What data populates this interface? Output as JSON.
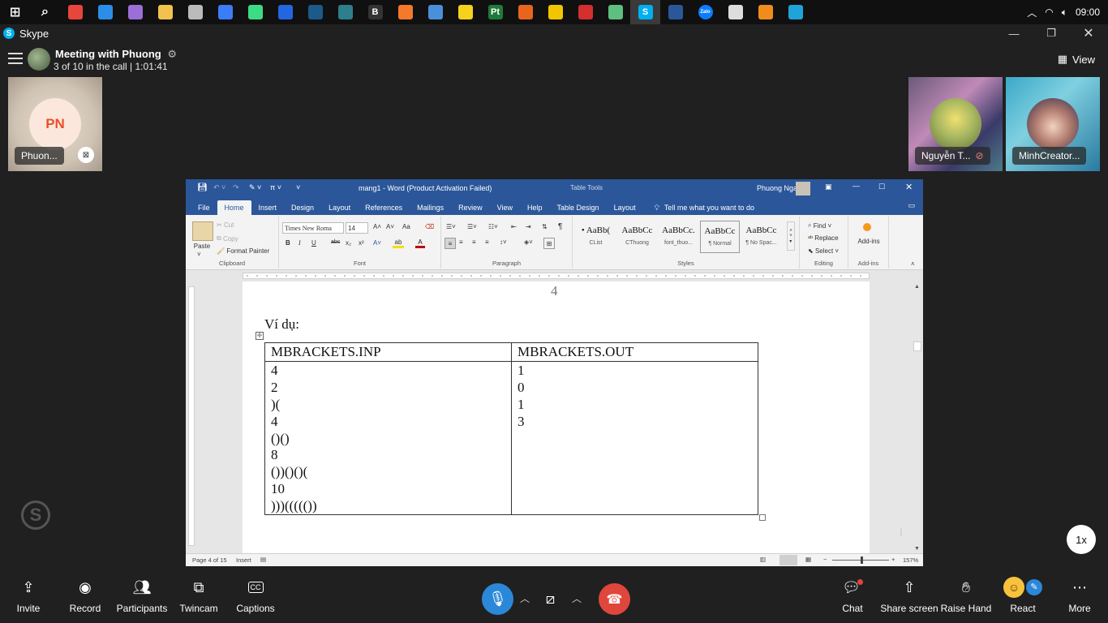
{
  "taskbar": {
    "time": "09:00",
    "apps": [
      {
        "icon": "start-icon",
        "glyph": "",
        "color": "#ffffff"
      },
      {
        "icon": "search-icon",
        "glyph": "",
        "color": "#ffffff"
      },
      {
        "icon": "chrome-icon",
        "glyph": "",
        "color": "#e8453c"
      },
      {
        "icon": "vscode-icon",
        "glyph": "",
        "color": "#2b8ee6"
      },
      {
        "icon": "store-icon",
        "glyph": "",
        "color": "#9b6ed8"
      },
      {
        "icon": "folder-icon",
        "glyph": "",
        "color": "#f2c14e"
      },
      {
        "icon": "check-app-icon",
        "glyph": "",
        "color": "#bbbbbb"
      },
      {
        "icon": "app-blue-icon",
        "glyph": "",
        "color": "#3c7cf6"
      },
      {
        "icon": "android-icon",
        "glyph": "",
        "color": "#3ddc84"
      },
      {
        "icon": "app-square-icon",
        "glyph": "",
        "color": "#2466e0"
      },
      {
        "icon": "steam-icon",
        "glyph": "",
        "color": "#1b5a8a"
      },
      {
        "icon": "app-dark-icon",
        "glyph": "",
        "color": "#2d7f8c"
      },
      {
        "icon": "b-app-icon",
        "glyph": "B",
        "color": "#333333"
      },
      {
        "icon": "blender-icon",
        "glyph": "",
        "color": "#f5792a"
      },
      {
        "icon": "gear-app-icon",
        "glyph": "",
        "color": "#4a90d9"
      },
      {
        "icon": "yellow-app-icon",
        "glyph": "",
        "color": "#f5d21b"
      },
      {
        "icon": "packet-tracer-icon",
        "glyph": "Pt",
        "color": "#1e7a3b"
      },
      {
        "icon": "search-app-icon",
        "glyph": "",
        "color": "#e8661c"
      },
      {
        "icon": "duck-icon",
        "glyph": "",
        "color": "#f2c500"
      },
      {
        "icon": "record-app-icon",
        "glyph": "",
        "color": "#d32f2f"
      },
      {
        "icon": "diamond-app-icon",
        "glyph": "",
        "color": "#5fbf7f"
      },
      {
        "icon": "skype-taskbar-icon",
        "glyph": "S",
        "color": "#00aff0"
      },
      {
        "icon": "word-taskbar-icon",
        "glyph": "",
        "color": "#2b579a"
      },
      {
        "icon": "zalo-icon",
        "glyph": "Zalo",
        "color": "#0a7cff"
      },
      {
        "icon": "file-app-icon",
        "glyph": "",
        "color": "#dddddd"
      },
      {
        "icon": "sublime-icon",
        "glyph": "",
        "color": "#f08c1c"
      },
      {
        "icon": "app-cyan-icon",
        "glyph": "",
        "color": "#1fa3d9"
      }
    ]
  },
  "skype": {
    "title": "Skype",
    "meeting_title": "Meeting with Phuong",
    "meeting_sub": "3 of 10 in the call | 1:01:41",
    "view_label": "View",
    "speed_label": "1x",
    "participants": [
      {
        "initials": "PN",
        "name": "Phuon..."
      },
      {
        "name": "Nguyễn T..."
      },
      {
        "name": "MinhCreator..."
      }
    ],
    "bottom": {
      "invite": "Invite",
      "record": "Record",
      "participants": "Participants",
      "twincam": "Twincam",
      "captions": "Captions",
      "captions_glyph": "CC",
      "chat": "Chat",
      "share": "Share screen",
      "raise": "Raise Hand",
      "react": "React",
      "more": "More"
    }
  },
  "word": {
    "title": "mang1 - Word (Product Activation Failed)",
    "table_tools": "Table Tools",
    "user": "Phuong Nga",
    "tabs": [
      "File",
      "Home",
      "Insert",
      "Design",
      "Layout",
      "References",
      "Mailings",
      "Review",
      "View",
      "Help",
      "Table Design",
      "Layout"
    ],
    "tell_me": "Tell me what you want to do",
    "clipboard": {
      "paste": "Paste",
      "cut": "Cut",
      "copy": "Copy",
      "format_painter": "Format Painter",
      "label": "Clipboard"
    },
    "font": {
      "name": "Times New Roma",
      "size": "14",
      "label": "Font",
      "bold": "B",
      "italic": "I",
      "underline": "U",
      "strike": "abc",
      "sub": "x₂",
      "sup": "x²",
      "grow": "A˄",
      "shrink": "A˅",
      "case": "Aa",
      "color": "A"
    },
    "paragraph_label": "Paragraph",
    "styles": {
      "label": "Styles",
      "items": [
        {
          "sample": "• AaBb(",
          "name": "CList"
        },
        {
          "sample": "AaBbCc",
          "name": "CThuong"
        },
        {
          "sample": "AaBbCc.",
          "name": "font_thuo..."
        },
        {
          "sample": "AaBbCc",
          "name": "¶ Normal"
        },
        {
          "sample": "AaBbCc",
          "name": "¶ No Spac..."
        }
      ]
    },
    "editing": {
      "find": "Find",
      "replace": "Replace",
      "select": "Select",
      "label": "Editing"
    },
    "addins": {
      "button": "Add-ins",
      "label": "Add-ins"
    },
    "page_number": "4",
    "heading": "Ví dụ:",
    "table": {
      "headers": [
        "MBRACKETS.INP",
        "MBRACKETS.OUT"
      ],
      "inp": [
        "4",
        "2",
        ")(",
        "4",
        "()()",
        "8",
        "())()()(",
        "10",
        ")))((((())"
      ],
      "out": [
        "1",
        "0",
        "1",
        "3"
      ]
    },
    "status": {
      "page": "Page 4 of 15",
      "mode": "Insert",
      "zoom": "157%"
    }
  }
}
